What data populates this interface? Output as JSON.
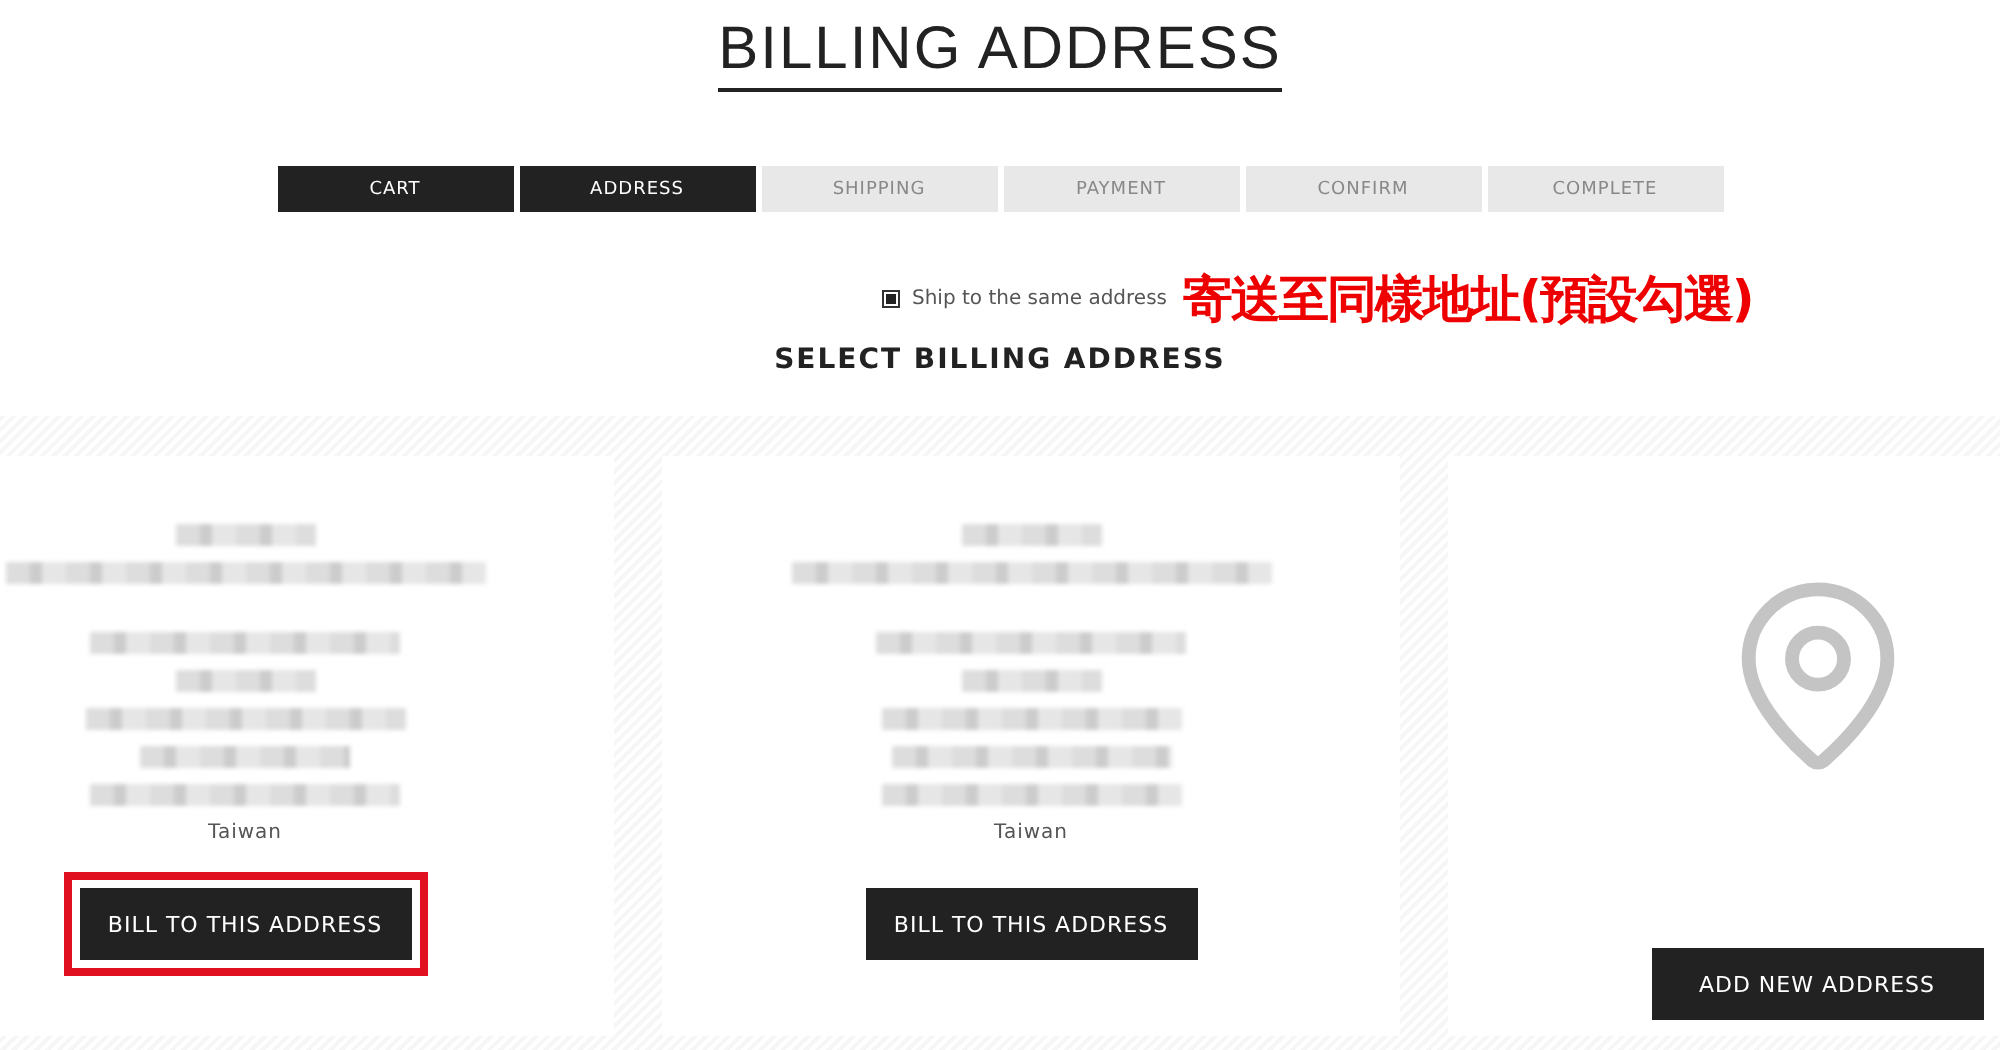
{
  "title": "BILLING ADDRESS",
  "steps": [
    {
      "label": "CART",
      "selected": true
    },
    {
      "label": "ADDRESS",
      "selected": true
    },
    {
      "label": "SHIPPING",
      "selected": false
    },
    {
      "label": "PAYMENT",
      "selected": false
    },
    {
      "label": "CONFIRM",
      "selected": false
    },
    {
      "label": "COMPLETE",
      "selected": false
    }
  ],
  "same_address": {
    "label": "Ship to the same address",
    "checked": true
  },
  "annotation": "寄送至同樣地址(預設勾選)",
  "section_title": "SELECT BILLING ADDRESS",
  "cards": [
    {
      "kind": "address",
      "country": "Taiwan",
      "button": "BILL TO THIS ADDRESS",
      "highlighted": true
    },
    {
      "kind": "address",
      "country": "Taiwan",
      "button": "BILL TO THIS ADDRESS",
      "highlighted": false
    },
    {
      "kind": "new",
      "button": "ADD NEW ADDRESS"
    }
  ]
}
